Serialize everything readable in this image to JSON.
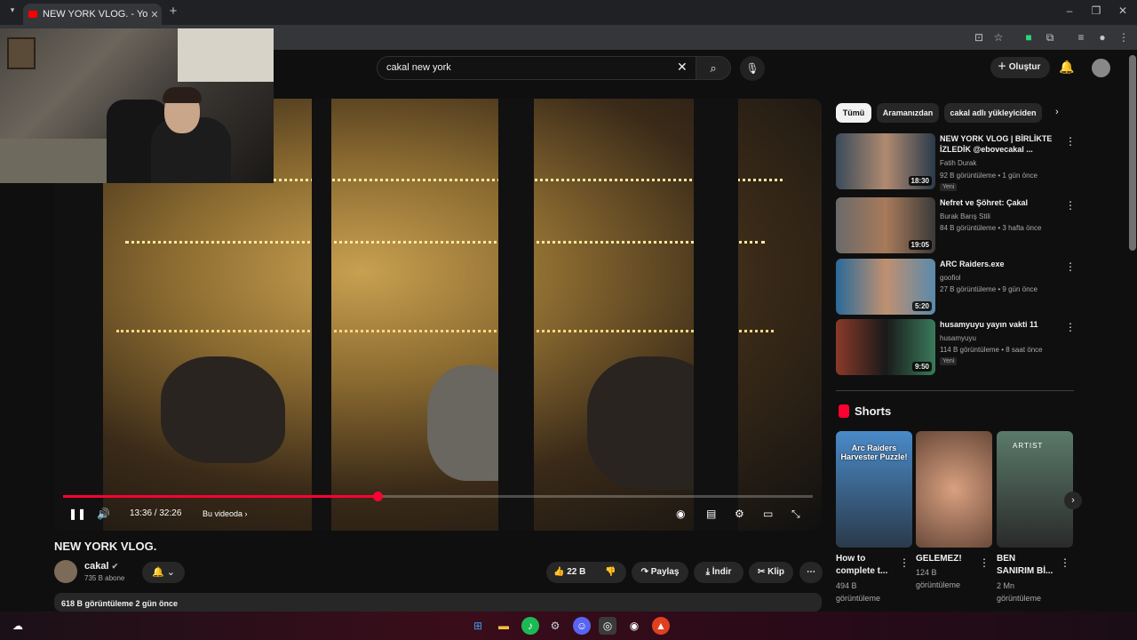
{
  "browser": {
    "tab_title": "NEW YORK VLOG. - YouTube",
    "icons": [
      "tab-menu-icon",
      "close-tab-icon",
      "new-tab-icon",
      "minimize-icon",
      "restore-icon",
      "close-window-icon",
      "install-icon",
      "star-icon",
      "extension-icon",
      "puzzle-icon",
      "media-icon",
      "profile-icon",
      "more-icon"
    ]
  },
  "header": {
    "search_value": "cakal new york",
    "create_label": "Oluştur"
  },
  "player": {
    "time": "13:36 / 32:26",
    "chapter": "Bu videoda",
    "progress_fraction": 0.42
  },
  "video": {
    "title": "NEW YORK VLOG.",
    "channel": "cakal",
    "subscribers": "735 B abone",
    "likes": "22 B",
    "share_label": "Paylaş",
    "download_label": "İndir",
    "clip_label": "Klip",
    "views_date": "618 B görüntüleme  2 gün önce"
  },
  "chips": [
    "Tümü",
    "Aramanızdan",
    "cakal adlı yükleyiciden"
  ],
  "recommendations": [
    {
      "title": "NEW YORK VLOG | BİRLİKTE İZLEDİK @ebovecakal ...",
      "channel": "Fatih Durak",
      "meta": "92 B görüntüleme • 1 gün önce",
      "duration": "18:30",
      "badge": "Yeni"
    },
    {
      "title": "Nefret ve Şöhret: Çakal",
      "channel": "Burak Barış Stili",
      "meta": "84 B görüntüleme • 3 hafta önce",
      "duration": "19:05",
      "badge": ""
    },
    {
      "title": "ARC Raiders.exe",
      "channel": "goofiol",
      "meta": "27 B görüntüleme • 9 gün önce",
      "duration": "5:20",
      "badge": ""
    },
    {
      "title": "husamyuyu yayın vakti 11",
      "channel": "husamyuyu",
      "meta": "114 B görüntüleme • 8 saat önce",
      "duration": "9:50",
      "badge": "Yeni"
    }
  ],
  "shorts": {
    "header": "Shorts",
    "items": [
      {
        "title": "How to complete t...",
        "views": "494 B görüntüleme",
        "overlay": "Arc Raiders Harvester Puzzle!"
      },
      {
        "title": "GELEMEZ!",
        "views": "124 B görüntüleme",
        "overlay": ""
      },
      {
        "title": "BEN SANIRIM Bİ...",
        "views": "2 Mn görüntüleme",
        "overlay": "ARTIST"
      }
    ]
  }
}
